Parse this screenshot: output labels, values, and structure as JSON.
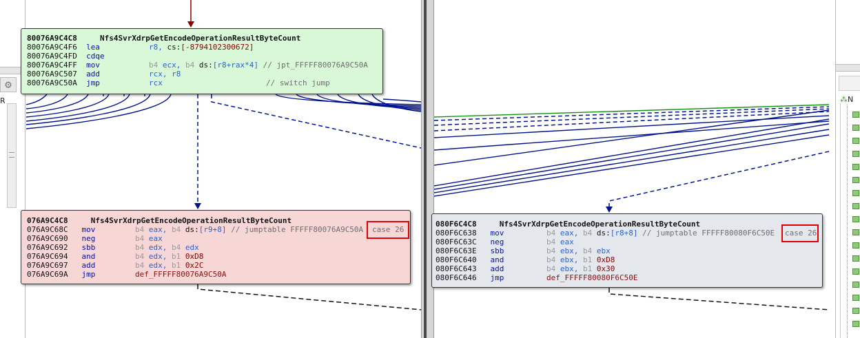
{
  "colors": {
    "block_green": "#d8f8d8",
    "block_red": "#f7d6d6",
    "block_gray": "#e4e8ec",
    "mnemonic": "#0a10a0",
    "register": "#2a62d0",
    "immediate": "#8a0000",
    "comment": "#6e6e6e",
    "edge_blue": "#00138a",
    "highlight_red": "#e00000"
  },
  "left_panel": {
    "column_label": "R"
  },
  "right_panel": {
    "tree_root_label": "N"
  },
  "left_graph": {
    "top_block": {
      "title_addr": "80076A9C4C8",
      "title": "Nfs4SvrXdrpGetEncodeOperationResultByteCount",
      "rows": [
        {
          "addr": "80076A9C4F6",
          "mn": "lea",
          "op1": "r8,",
          "seg": "cs:",
          "op2": "[-8794102300672]",
          "comment": ""
        },
        {
          "addr": "80076A9C4FD",
          "mn": "cdqe",
          "op1": "",
          "seg": "",
          "op2": "",
          "comment": ""
        },
        {
          "addr": "80076A9C4FF",
          "mn": "mov",
          "pf1": "b4",
          "op1": "ecx,",
          "pf2": "b4",
          "seg": "ds:",
          "op2": "[r8+rax*4]",
          "comment": "// jpt_FFFFF80076A9C50A"
        },
        {
          "addr": "80076A9C507",
          "mn": "add",
          "op1": "rcx, r8",
          "comment": ""
        },
        {
          "addr": "80076A9C50A",
          "mn": "jmp",
          "op1": "rcx",
          "comment": "// switch jump"
        }
      ]
    },
    "case_block": {
      "title_addr": "076A9C4C8",
      "title": "Nfs4SvrXdrpGetEncodeOperationResultByteCount",
      "case_label": "case 26",
      "rows": [
        {
          "addr": "076A9C68C",
          "mn": "mov",
          "pf1": "b4",
          "op1": "eax,",
          "pf2": "b4",
          "seg": "ds:",
          "op2": "[r9+8]",
          "comment": "// jumptable FFFFF80076A9C50A"
        },
        {
          "addr": "076A9C690",
          "mn": "neg",
          "pf1": "b4",
          "op1": "eax"
        },
        {
          "addr": "076A9C692",
          "mn": "sbb",
          "pf1": "b4",
          "op1": "edx,",
          "pf2": "b4",
          "op2": "edx"
        },
        {
          "addr": "076A9C694",
          "mn": "and",
          "pf1": "b4",
          "op1": "edx,",
          "pf2": "b1",
          "imm": "0xD8"
        },
        {
          "addr": "076A9C697",
          "mn": "add",
          "pf1": "b4",
          "op1": "edx,",
          "pf2": "b1",
          "imm": "0x2C"
        },
        {
          "addr": "076A9C69A",
          "mn": "jmp",
          "label": "def_FFFFF80076A9C50A"
        }
      ]
    }
  },
  "right_graph": {
    "case_block": {
      "title_addr": "080F6C4C8",
      "title": "Nfs4SvrXdrpGetEncodeOperationResultByteCount",
      "case_label": "case 26",
      "rows": [
        {
          "addr": "080F6C638",
          "mn": "mov",
          "pf1": "b4",
          "op1": "eax,",
          "pf2": "b4",
          "seg": "ds:",
          "op2": "[r8+8]",
          "comment": "// jumptable FFFFF80080F6C50E"
        },
        {
          "addr": "080F6C63C",
          "mn": "neg",
          "pf1": "b4",
          "op1": "eax"
        },
        {
          "addr": "080F6C63E",
          "mn": "sbb",
          "pf1": "b4",
          "op1": "ebx,",
          "pf2": "b4",
          "op2": "ebx"
        },
        {
          "addr": "080F6C640",
          "mn": "and",
          "pf1": "b4",
          "op1": "ebx,",
          "pf2": "b1",
          "imm": "0xD8"
        },
        {
          "addr": "080F6C643",
          "mn": "add",
          "pf1": "b4",
          "op1": "ebx,",
          "pf2": "b1",
          "imm": "0x30"
        },
        {
          "addr": "080F6C646",
          "mn": "jmp",
          "label": "def_FFFFF80080F6C50E"
        }
      ]
    }
  }
}
